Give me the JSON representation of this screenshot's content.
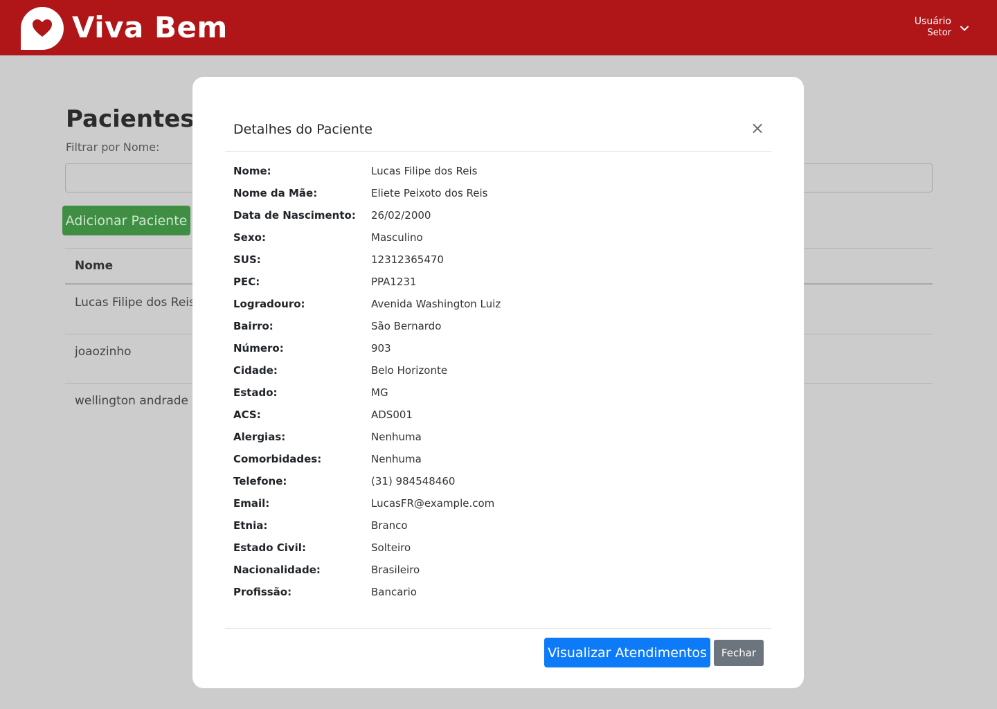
{
  "app": {
    "brand": "Viva Bem",
    "colors": {
      "header": "#b01517",
      "primary": "#0d7bf7",
      "success": "#3f8e44",
      "secondary": "#6c757d"
    },
    "icons": {
      "logo": "heart-chat-bubble-icon",
      "user_menu": "chevron-down-icon",
      "close": "close-icon"
    }
  },
  "user": {
    "name": "Usuário",
    "sector": "Setor"
  },
  "page": {
    "title": "Pacientes",
    "filter_label": "Filtrar por Nome:",
    "filter_value": "",
    "add_button": "Adicionar Paciente",
    "table": {
      "columns": [
        "Nome"
      ],
      "rows": [
        "Lucas Filipe dos Reis",
        "joaozinho",
        "wellington andrade"
      ]
    }
  },
  "modal": {
    "title": "Detalhes do Paciente",
    "close_symbol": "×",
    "fields": [
      {
        "label": "Nome:",
        "value": "Lucas Filipe dos Reis"
      },
      {
        "label": "Nome da Mãe:",
        "value": "Eliete Peixoto dos Reis"
      },
      {
        "label": "Data de Nascimento:",
        "value": "26/02/2000"
      },
      {
        "label": "Sexo:",
        "value": "Masculino"
      },
      {
        "label": "SUS:",
        "value": "12312365470"
      },
      {
        "label": "PEC:",
        "value": "PPA1231"
      },
      {
        "label": "Logradouro:",
        "value": "Avenida Washington Luiz"
      },
      {
        "label": "Bairro:",
        "value": "São Bernardo"
      },
      {
        "label": "Número:",
        "value": "903"
      },
      {
        "label": "Cidade:",
        "value": "Belo Horizonte"
      },
      {
        "label": "Estado:",
        "value": "MG"
      },
      {
        "label": "ACS:",
        "value": "ADS001"
      },
      {
        "label": "Alergias:",
        "value": "Nenhuma"
      },
      {
        "label": "Comorbidades:",
        "value": "Nenhuma"
      },
      {
        "label": "Telefone:",
        "value": "(31) 984548460"
      },
      {
        "label": "Email:",
        "value": "LucasFR@example.com"
      },
      {
        "label": "Etnia:",
        "value": "Branco"
      },
      {
        "label": "Estado Civil:",
        "value": "Solteiro"
      },
      {
        "label": "Nacionalidade:",
        "value": "Brasileiro"
      },
      {
        "label": "Profissão:",
        "value": "Bancario"
      }
    ],
    "primary_button": "Visualizar Atendimentos",
    "secondary_button": "Fechar"
  }
}
